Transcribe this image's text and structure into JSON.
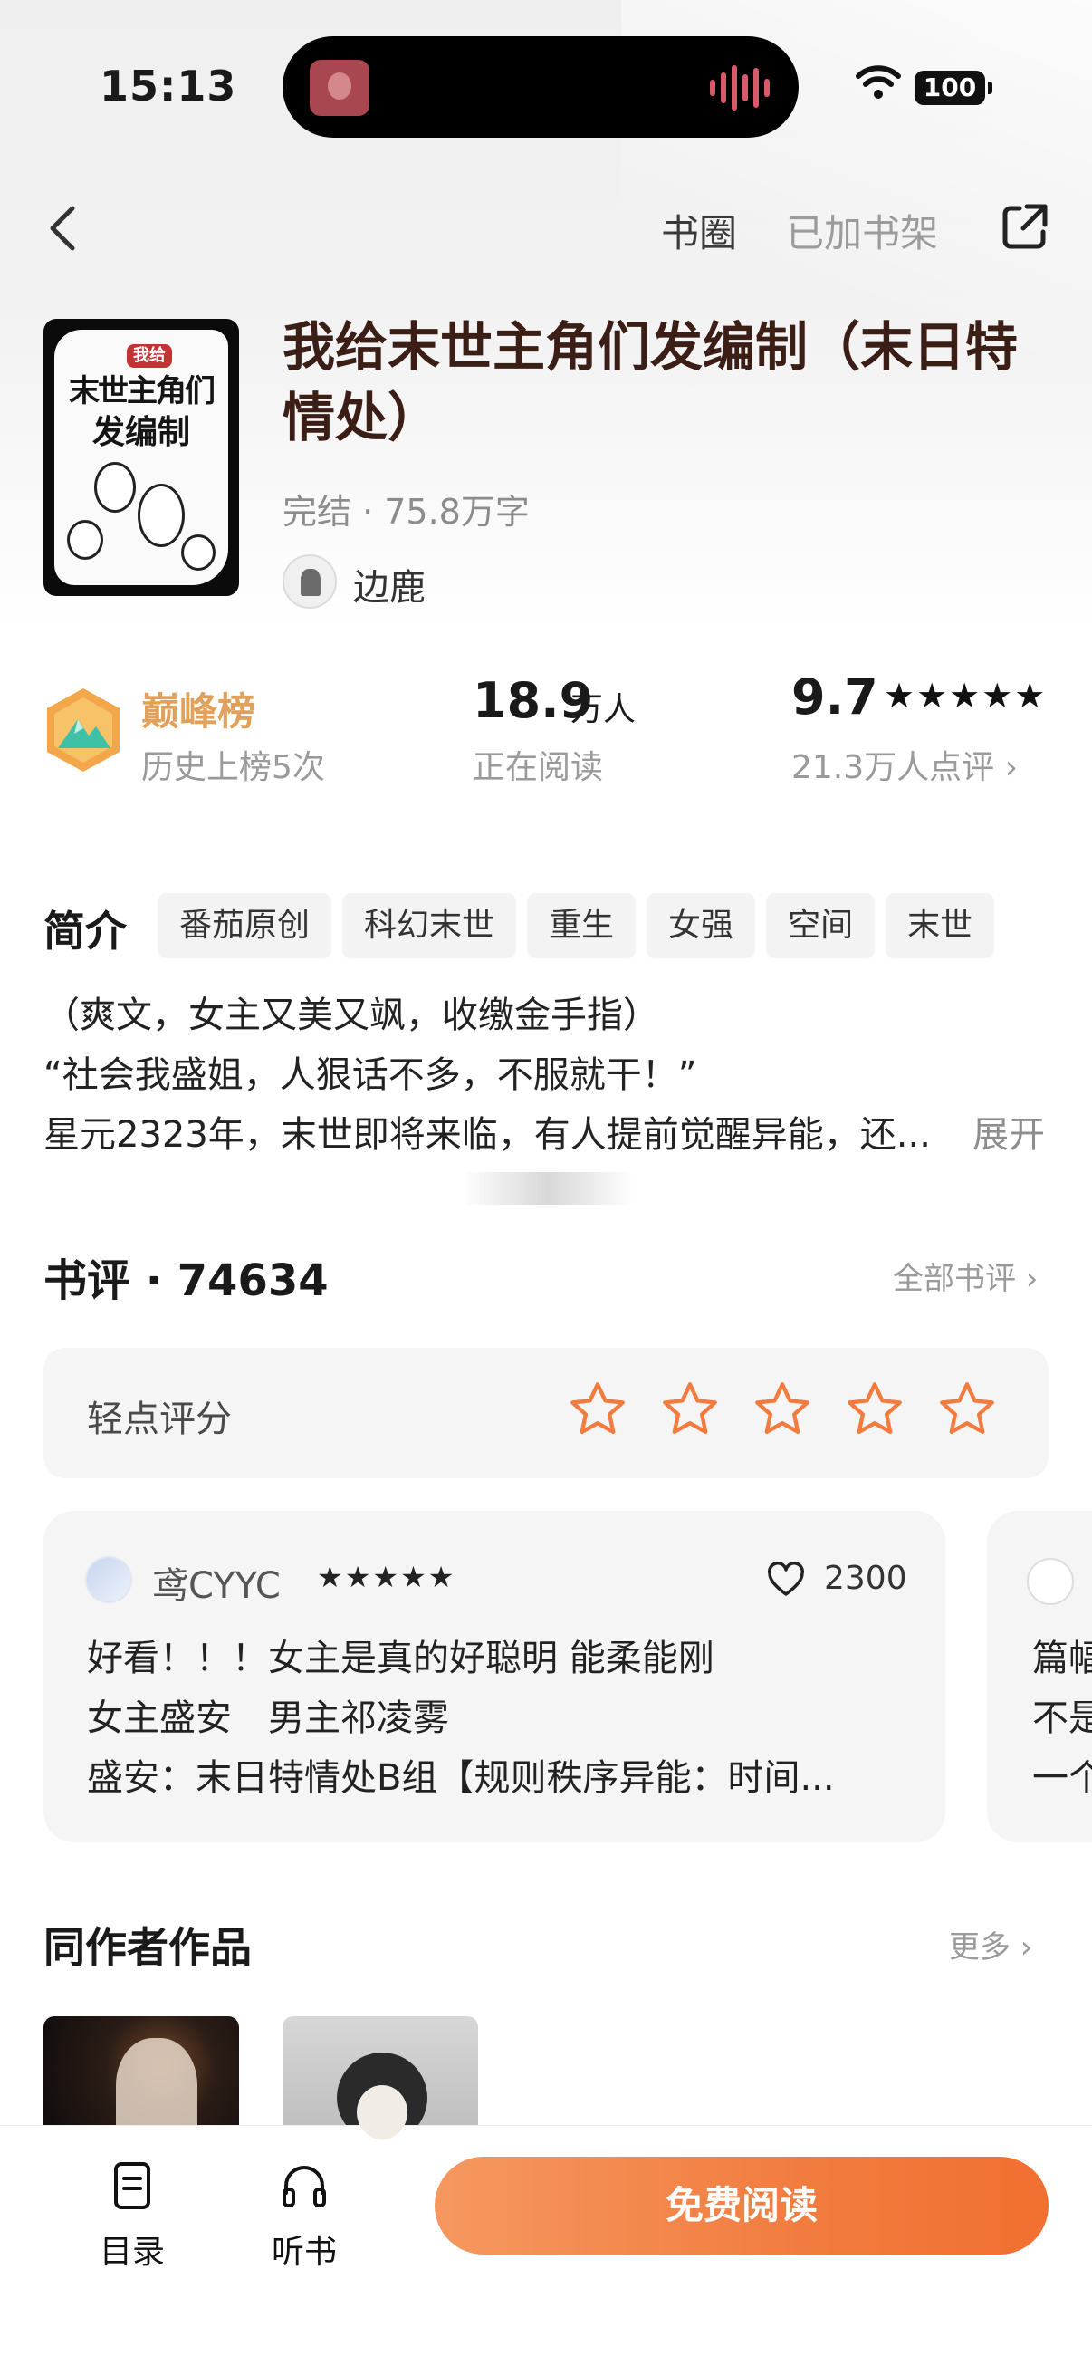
{
  "status": {
    "time": "15:13",
    "battery": "100"
  },
  "nav": {
    "circle": "书圈",
    "shelf": "已加书架"
  },
  "book": {
    "cover_tag": "我给",
    "cover_title_line1": "末世主角们",
    "cover_title_line2": "发编制",
    "title": "我给末世主角们发编制（末日特情处）",
    "meta": "完结 · 75.8万字",
    "author": "边鹿"
  },
  "stats": {
    "rank_name": "巅峰榜",
    "rank_sub": "历史上榜5次",
    "readers_num": "18.9",
    "readers_unit": "万人",
    "readers_label": "正在阅读",
    "score": "9.7",
    "score_stars": "★★★★★",
    "score_label": "21.3万人点评 ›"
  },
  "intro": {
    "heading": "简介",
    "tags": [
      "番茄原创",
      "科幻末世",
      "重生",
      "女强",
      "空间",
      "末世"
    ],
    "lines": [
      "（爽文，女主又美又飒，收缴金手指）",
      "“社会我盛姐，人狠话不多，不服就干！”",
      "星元2323年，末世即将来临，有人提前觉醒异能，还..."
    ],
    "expand": "展开"
  },
  "reviews": {
    "heading": "书评 · 74634",
    "all_link": "全部书评 ›",
    "rate_label": "轻点评分",
    "card": {
      "user": "鸢CYYC",
      "stars": "★★★★★",
      "likes": "2300",
      "lines": [
        "好看！！！女主是真的好聪明 能柔能刚",
        "女主盛安　男主祁凌雾",
        "盛安：末日特情处B组【规则秩序异能：时间..."
      ]
    },
    "card2_lines": [
      "篇幅",
      "不是",
      "一个"
    ]
  },
  "works": {
    "heading": "同作者作品",
    "more": "更多 ›"
  },
  "bottom": {
    "toc": "目录",
    "listen": "听书",
    "read": "免费阅读"
  },
  "colors": {
    "accent": "#f27c3f",
    "title": "#3b1f17",
    "rank": "#e2a15a"
  }
}
